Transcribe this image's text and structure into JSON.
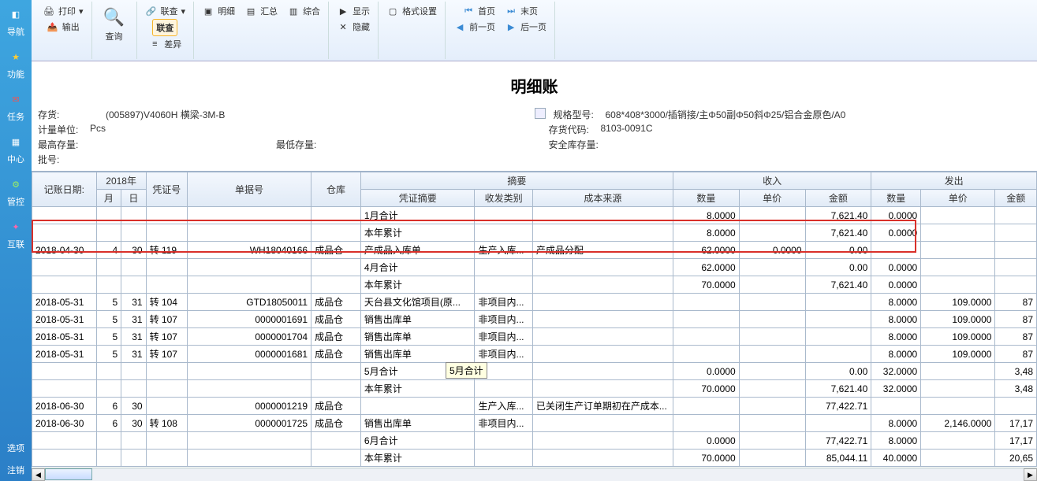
{
  "sidebar": {
    "items": [
      {
        "label": "导航",
        "icon": "nav"
      },
      {
        "label": "功能",
        "icon": "star"
      },
      {
        "label": "任务",
        "icon": "mail"
      },
      {
        "label": "中心",
        "icon": "grid"
      },
      {
        "label": "管控",
        "icon": "gear"
      },
      {
        "label": "互联",
        "icon": "share"
      },
      {
        "label": "选项",
        "icon": "opt"
      },
      {
        "label": "注销",
        "icon": "logout"
      }
    ]
  },
  "ribbon": {
    "g1": {
      "print": "打印",
      "output": "输出"
    },
    "g2": {
      "query": "查询",
      "lookup": "联查",
      "lookup2": "联查",
      "diff": "差异"
    },
    "g3": {
      "detail": "明细",
      "summary": "汇总",
      "combine": "综合"
    },
    "g4": {
      "show": "显示",
      "hide": "隐藏"
    },
    "g5": {
      "format": "格式设置"
    },
    "g6": {
      "first": "首页",
      "last": "末页",
      "prev": "前一页",
      "next": "后一页"
    }
  },
  "page_title": "明细账",
  "info": {
    "stock_label": "存货:",
    "stock_val": "(005897)V4060H 横梁-3M-B",
    "unit_label": "计量单位:",
    "unit_val": "Pcs",
    "max_label": "最高存量:",
    "max_val": "",
    "min_label": "最低存量:",
    "min_val": "",
    "batch_label": "批号:",
    "spec_label": "规格型号:",
    "spec_val": "608*408*3000/插销接/主Φ50副Φ50斜Φ25/铝合金原色/A0",
    "code_label": "存货代码:",
    "code_val": "8103-0091C",
    "safe_label": "安全库存量:",
    "safe_val": ""
  },
  "grid": {
    "headers": {
      "post_date": "记账日期:",
      "year": "2018年",
      "month": "月",
      "day": "日",
      "voucher": "凭证号",
      "bill": "单据号",
      "warehouse": "仓库",
      "summary_group": "摘要",
      "summary": "凭证摘要",
      "rcv_type": "收发类别",
      "cost_src": "成本来源",
      "income_group": "收入",
      "qty": "数量",
      "price": "单价",
      "amount": "金额",
      "outgoing_group": "发出",
      "qty2": "数量",
      "price2": "单价",
      "amount2": "金额"
    },
    "rows": [
      {
        "date": "",
        "m": "",
        "d": "",
        "voucher": "",
        "bill": "",
        "wh": "",
        "summary": "1月合计",
        "rtype": "",
        "csrc": "",
        "in_qty": "8.0000",
        "in_price": "",
        "in_amt": "7,621.40",
        "out_qty": "0.0000",
        "out_price": "",
        "out_amt": ""
      },
      {
        "date": "",
        "m": "",
        "d": "",
        "voucher": "",
        "bill": "",
        "wh": "",
        "summary": "本年累计",
        "rtype": "",
        "csrc": "",
        "in_qty": "8.0000",
        "in_price": "",
        "in_amt": "7,621.40",
        "out_qty": "0.0000",
        "out_price": "",
        "out_amt": ""
      },
      {
        "date": "2018-04-30",
        "m": "4",
        "d": "30",
        "voucher": "转 119",
        "bill": "WH18040166",
        "wh": "成品仓",
        "summary": "产成品入库单",
        "rtype": "生产入库...",
        "csrc": "产成品分配",
        "in_qty": "62.0000",
        "in_price": "0.0000",
        "in_amt": "0.00",
        "out_qty": "",
        "out_price": "",
        "out_amt": ""
      },
      {
        "date": "",
        "m": "",
        "d": "",
        "voucher": "",
        "bill": "",
        "wh": "",
        "summary": "4月合计",
        "rtype": "",
        "csrc": "",
        "in_qty": "62.0000",
        "in_price": "",
        "in_amt": "0.00",
        "out_qty": "0.0000",
        "out_price": "",
        "out_amt": ""
      },
      {
        "date": "",
        "m": "",
        "d": "",
        "voucher": "",
        "bill": "",
        "wh": "",
        "summary": "本年累计",
        "rtype": "",
        "csrc": "",
        "in_qty": "70.0000",
        "in_price": "",
        "in_amt": "7,621.40",
        "out_qty": "0.0000",
        "out_price": "",
        "out_amt": ""
      },
      {
        "date": "2018-05-31",
        "m": "5",
        "d": "31",
        "voucher": "转 104",
        "bill": "GTD18050011",
        "wh": "成品仓",
        "summary": "天台县文化馆项目(原...",
        "rtype": "非项目内...",
        "csrc": "",
        "in_qty": "",
        "in_price": "",
        "in_amt": "",
        "out_qty": "8.0000",
        "out_price": "109.0000",
        "out_amt": "87"
      },
      {
        "date": "2018-05-31",
        "m": "5",
        "d": "31",
        "voucher": "转 107",
        "bill": "0000001691",
        "wh": "成品仓",
        "summary": "销售出库单",
        "rtype": "非项目内...",
        "csrc": "",
        "in_qty": "",
        "in_price": "",
        "in_amt": "",
        "out_qty": "8.0000",
        "out_price": "109.0000",
        "out_amt": "87"
      },
      {
        "date": "2018-05-31",
        "m": "5",
        "d": "31",
        "voucher": "转 107",
        "bill": "0000001704",
        "wh": "成品仓",
        "summary": "销售出库单",
        "rtype": "非项目内...",
        "csrc": "",
        "in_qty": "",
        "in_price": "",
        "in_amt": "",
        "out_qty": "8.0000",
        "out_price": "109.0000",
        "out_amt": "87"
      },
      {
        "date": "2018-05-31",
        "m": "5",
        "d": "31",
        "voucher": "转 107",
        "bill": "0000001681",
        "wh": "成品仓",
        "summary": "销售出库单",
        "rtype": "非项目内...",
        "csrc": "",
        "in_qty": "",
        "in_price": "",
        "in_amt": "",
        "out_qty": "8.0000",
        "out_price": "109.0000",
        "out_amt": "87"
      },
      {
        "date": "",
        "m": "",
        "d": "",
        "voucher": "",
        "bill": "",
        "wh": "",
        "summary": "5月合计",
        "rtype": "",
        "csrc": "",
        "in_qty": "0.0000",
        "in_price": "",
        "in_amt": "0.00",
        "out_qty": "32.0000",
        "out_price": "",
        "out_amt": "3,48"
      },
      {
        "date": "",
        "m": "",
        "d": "",
        "voucher": "",
        "bill": "",
        "wh": "",
        "summary": "本年累计",
        "rtype": "",
        "csrc": "",
        "in_qty": "70.0000",
        "in_price": "",
        "in_amt": "7,621.40",
        "out_qty": "32.0000",
        "out_price": "",
        "out_amt": "3,48"
      },
      {
        "date": "2018-06-30",
        "m": "6",
        "d": "30",
        "voucher": "",
        "bill": "0000001219",
        "wh": "成品仓",
        "summary": "",
        "rtype": "生产入库...",
        "csrc": "已关闭生产订单期初在产成本...",
        "in_qty": "",
        "in_price": "",
        "in_amt": "77,422.71",
        "out_qty": "",
        "out_price": "",
        "out_amt": ""
      },
      {
        "date": "2018-06-30",
        "m": "6",
        "d": "30",
        "voucher": "转 108",
        "bill": "0000001725",
        "wh": "成品仓",
        "summary": "销售出库单",
        "rtype": "非项目内...",
        "csrc": "",
        "in_qty": "",
        "in_price": "",
        "in_amt": "",
        "out_qty": "8.0000",
        "out_price": "2,146.0000",
        "out_amt": "17,17"
      },
      {
        "date": "",
        "m": "",
        "d": "",
        "voucher": "",
        "bill": "",
        "wh": "",
        "summary": "6月合计",
        "rtype": "",
        "csrc": "",
        "in_qty": "0.0000",
        "in_price": "",
        "in_amt": "77,422.71",
        "out_qty": "8.0000",
        "out_price": "",
        "out_amt": "17,17"
      },
      {
        "date": "",
        "m": "",
        "d": "",
        "voucher": "",
        "bill": "",
        "wh": "",
        "summary": "本年累计",
        "rtype": "",
        "csrc": "",
        "in_qty": "70.0000",
        "in_price": "",
        "in_amt": "85,044.11",
        "out_qty": "40.0000",
        "out_price": "",
        "out_amt": "20,65"
      }
    ]
  },
  "tooltip": "5月合计"
}
